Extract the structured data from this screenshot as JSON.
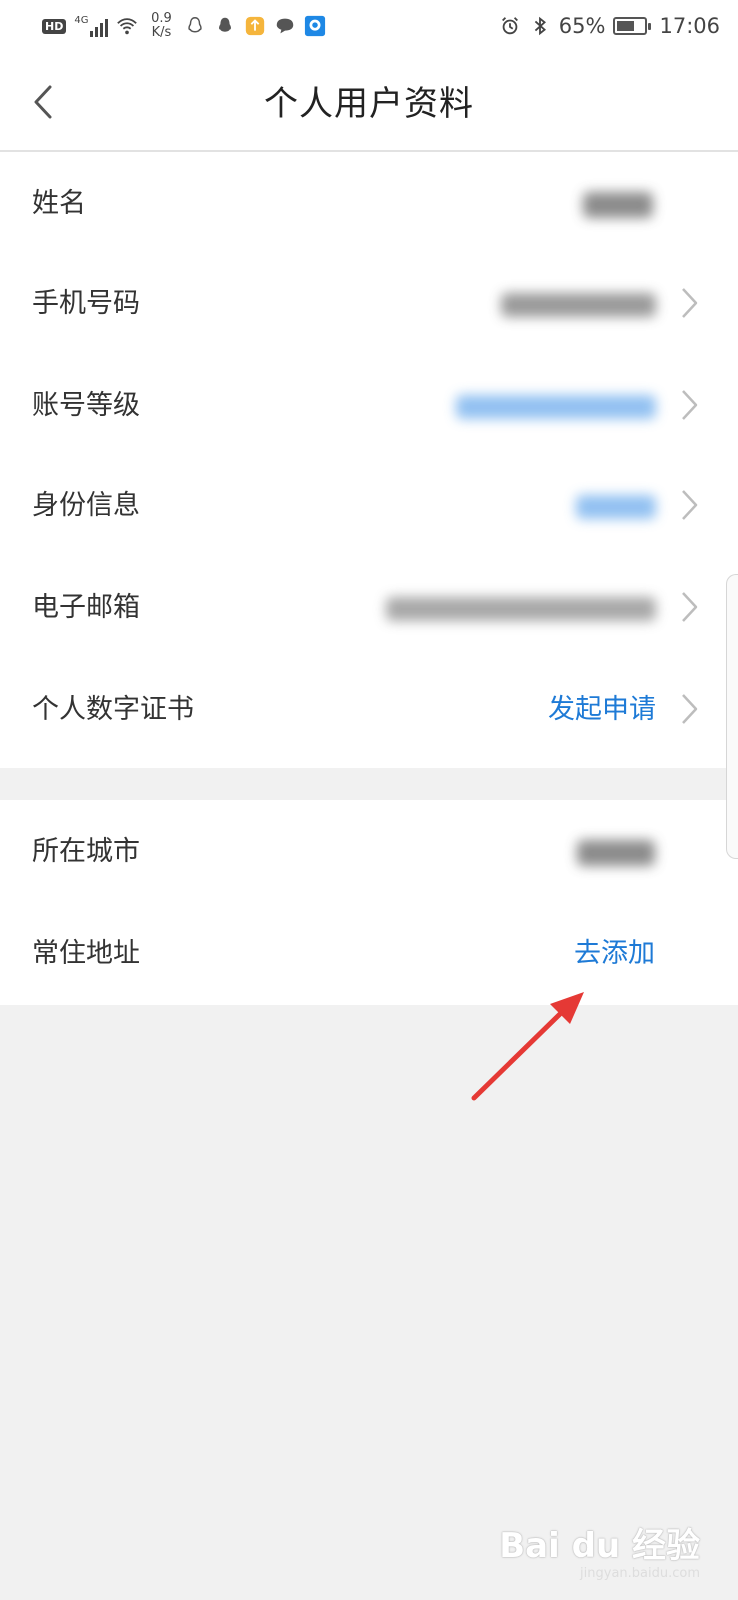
{
  "status_bar": {
    "hd_badge": "HD",
    "signal_label": "4G",
    "net_speed_value": "0.9",
    "net_speed_unit": "K/s",
    "battery_percent": "65%",
    "battery_level": 0.65,
    "time": "17:06"
  },
  "header": {
    "title": "个人用户资料"
  },
  "profile": {
    "rows": [
      {
        "label": "姓名",
        "value": ""
      },
      {
        "label": "手机号码",
        "value": ""
      },
      {
        "label": "账号等级",
        "value": ""
      },
      {
        "label": "身份信息",
        "value": ""
      },
      {
        "label": "电子邮箱",
        "value": ""
      },
      {
        "label": "个人数字证书",
        "value": "发起申请"
      }
    ]
  },
  "location": {
    "rows": [
      {
        "label": "所在城市",
        "value": ""
      },
      {
        "label": "常住地址",
        "value": "去添加"
      }
    ]
  },
  "colors": {
    "link_blue": "#1e7ad6",
    "annotation_red": "#e53935",
    "page_background": "#f1f1f1"
  },
  "watermark": {
    "brand": "Bai du 经验",
    "domain": "jingyan.baidu.com"
  }
}
